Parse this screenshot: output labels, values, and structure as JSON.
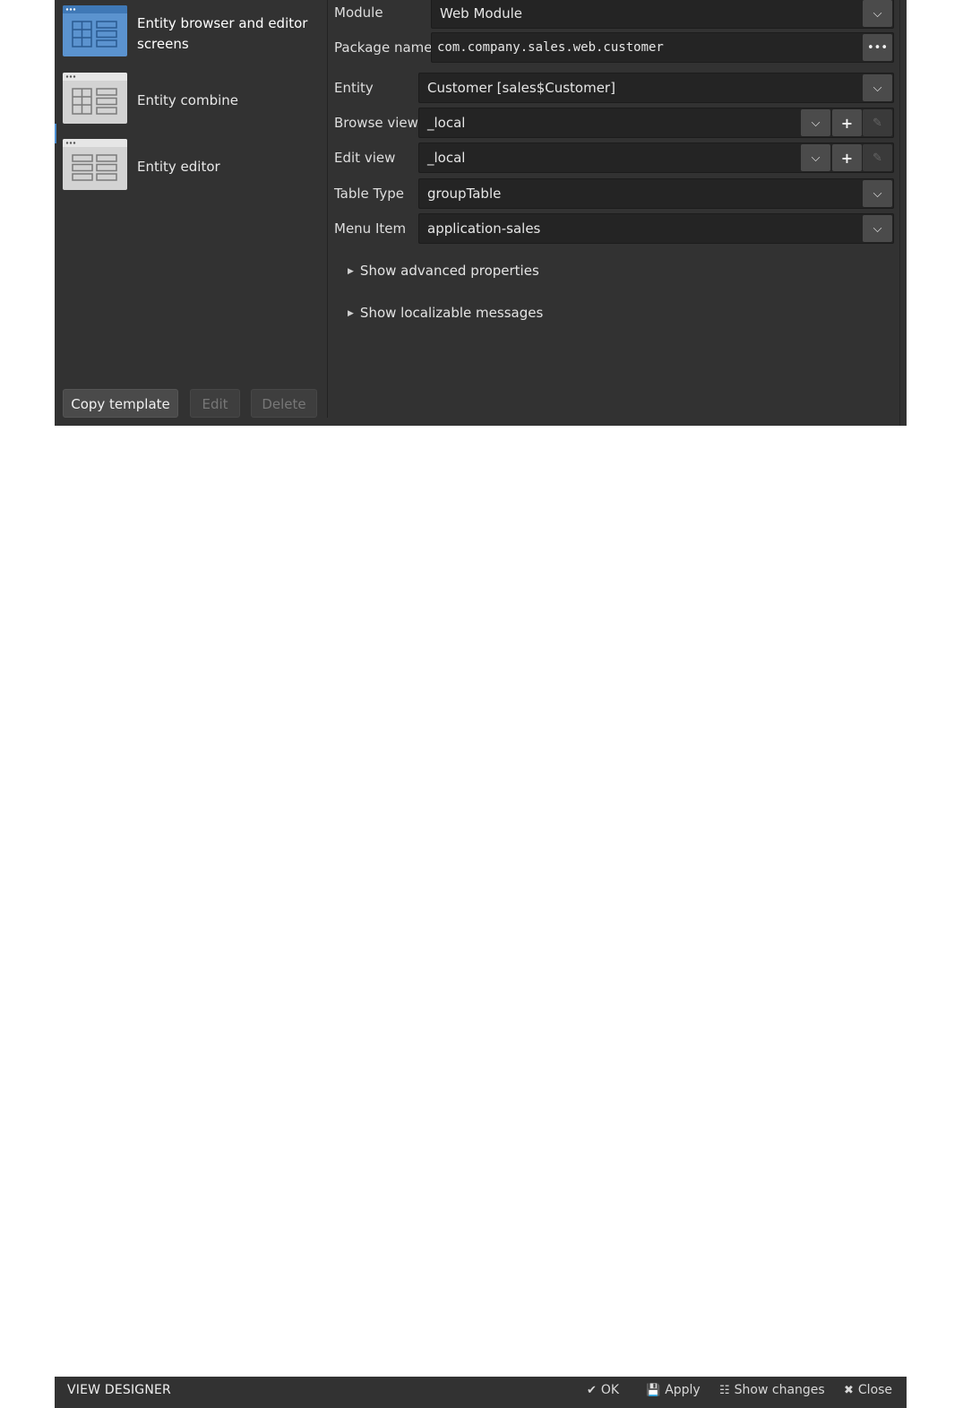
{
  "templates": [
    {
      "label": "Entity browser and editor screens",
      "selected": true,
      "icon": "entity-browser-icon"
    },
    {
      "label": "Entity combine",
      "selected": false,
      "icon": "entity-combine-icon"
    },
    {
      "label": "Entity editor",
      "selected": false,
      "icon": "entity-editor-icon"
    }
  ],
  "left_buttons": {
    "copy": "Copy template",
    "edit": "Edit",
    "delete": "Delete"
  },
  "fields": {
    "module": {
      "label": "Module",
      "value": "Web Module"
    },
    "package": {
      "label": "Package name",
      "value": "com.company.sales.web.customer"
    },
    "entity": {
      "label": "Entity",
      "value": "Customer [sales$Customer]"
    },
    "browse_view": {
      "label": "Browse view",
      "value": "_local"
    },
    "edit_view": {
      "label": "Edit view",
      "value": "_local"
    },
    "table_type": {
      "label": "Table Type",
      "value": "groupTable"
    },
    "menu_item": {
      "label": "Menu Item",
      "value": "application-sales"
    }
  },
  "expanders": {
    "advanced": "Show advanced properties",
    "localizable": "Show localizable messages"
  },
  "bottom_bar": {
    "title": "VIEW DESIGNER",
    "ok": "OK",
    "apply": "Apply",
    "show_changes": "Show changes",
    "close": "Close"
  },
  "colors": {
    "selected_icon": "#5b93cf",
    "background": "#323232",
    "field_bg": "#242424"
  }
}
